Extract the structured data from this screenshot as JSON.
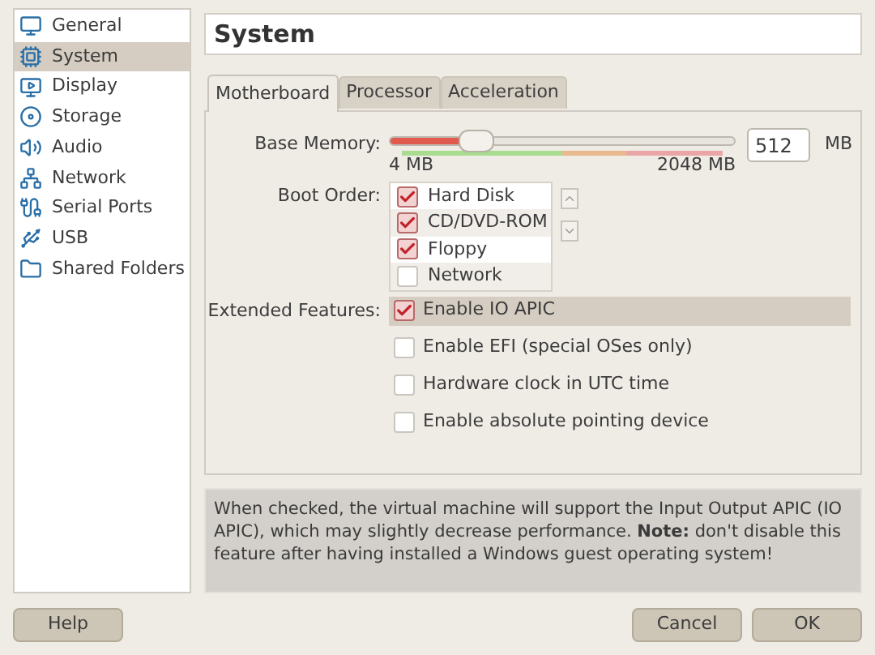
{
  "sidebar": {
    "items": [
      {
        "label": "General",
        "selected": false
      },
      {
        "label": "System",
        "selected": true
      },
      {
        "label": "Display",
        "selected": false
      },
      {
        "label": "Storage",
        "selected": false
      },
      {
        "label": "Audio",
        "selected": false
      },
      {
        "label": "Network",
        "selected": false
      },
      {
        "label": "Serial Ports",
        "selected": false
      },
      {
        "label": "USB",
        "selected": false
      },
      {
        "label": "Shared Folders",
        "selected": false
      }
    ]
  },
  "header": {
    "title": "System"
  },
  "tabs": [
    {
      "label": "Motherboard",
      "selected": true
    },
    {
      "label": "Processor",
      "selected": false
    },
    {
      "label": "Acceleration",
      "selected": false
    }
  ],
  "base_memory": {
    "label": "Base Memory:",
    "level": 0.25,
    "min_label": "4 MB",
    "max_label": "2048 MB",
    "value": "512",
    "unit": "MB"
  },
  "boot_order": {
    "label": "Boot Order:",
    "items": [
      {
        "label": "Hard Disk",
        "checked": true
      },
      {
        "label": "CD/DVD-ROM",
        "checked": true
      },
      {
        "label": "Floppy",
        "checked": true
      },
      {
        "label": "Network",
        "checked": false
      }
    ]
  },
  "extended_features": {
    "label": "Extended Features:",
    "items": [
      {
        "label": "Enable IO APIC",
        "checked": true,
        "selected": true
      },
      {
        "label": "Enable EFI (special OSes only)",
        "checked": false,
        "selected": false
      },
      {
        "label": "Hardware clock in UTC time",
        "checked": false,
        "selected": false
      },
      {
        "label": "Enable absolute pointing device",
        "checked": false,
        "selected": false
      }
    ]
  },
  "description": "When checked, the virtual machine will support the Input Output APIC (IO APIC), which may slightly decrease performance. **Note:** don't disable this feature after having installed a Windows guest operating system!",
  "buttons": {
    "help": "Help",
    "cancel": "Cancel",
    "ok": "OK"
  }
}
